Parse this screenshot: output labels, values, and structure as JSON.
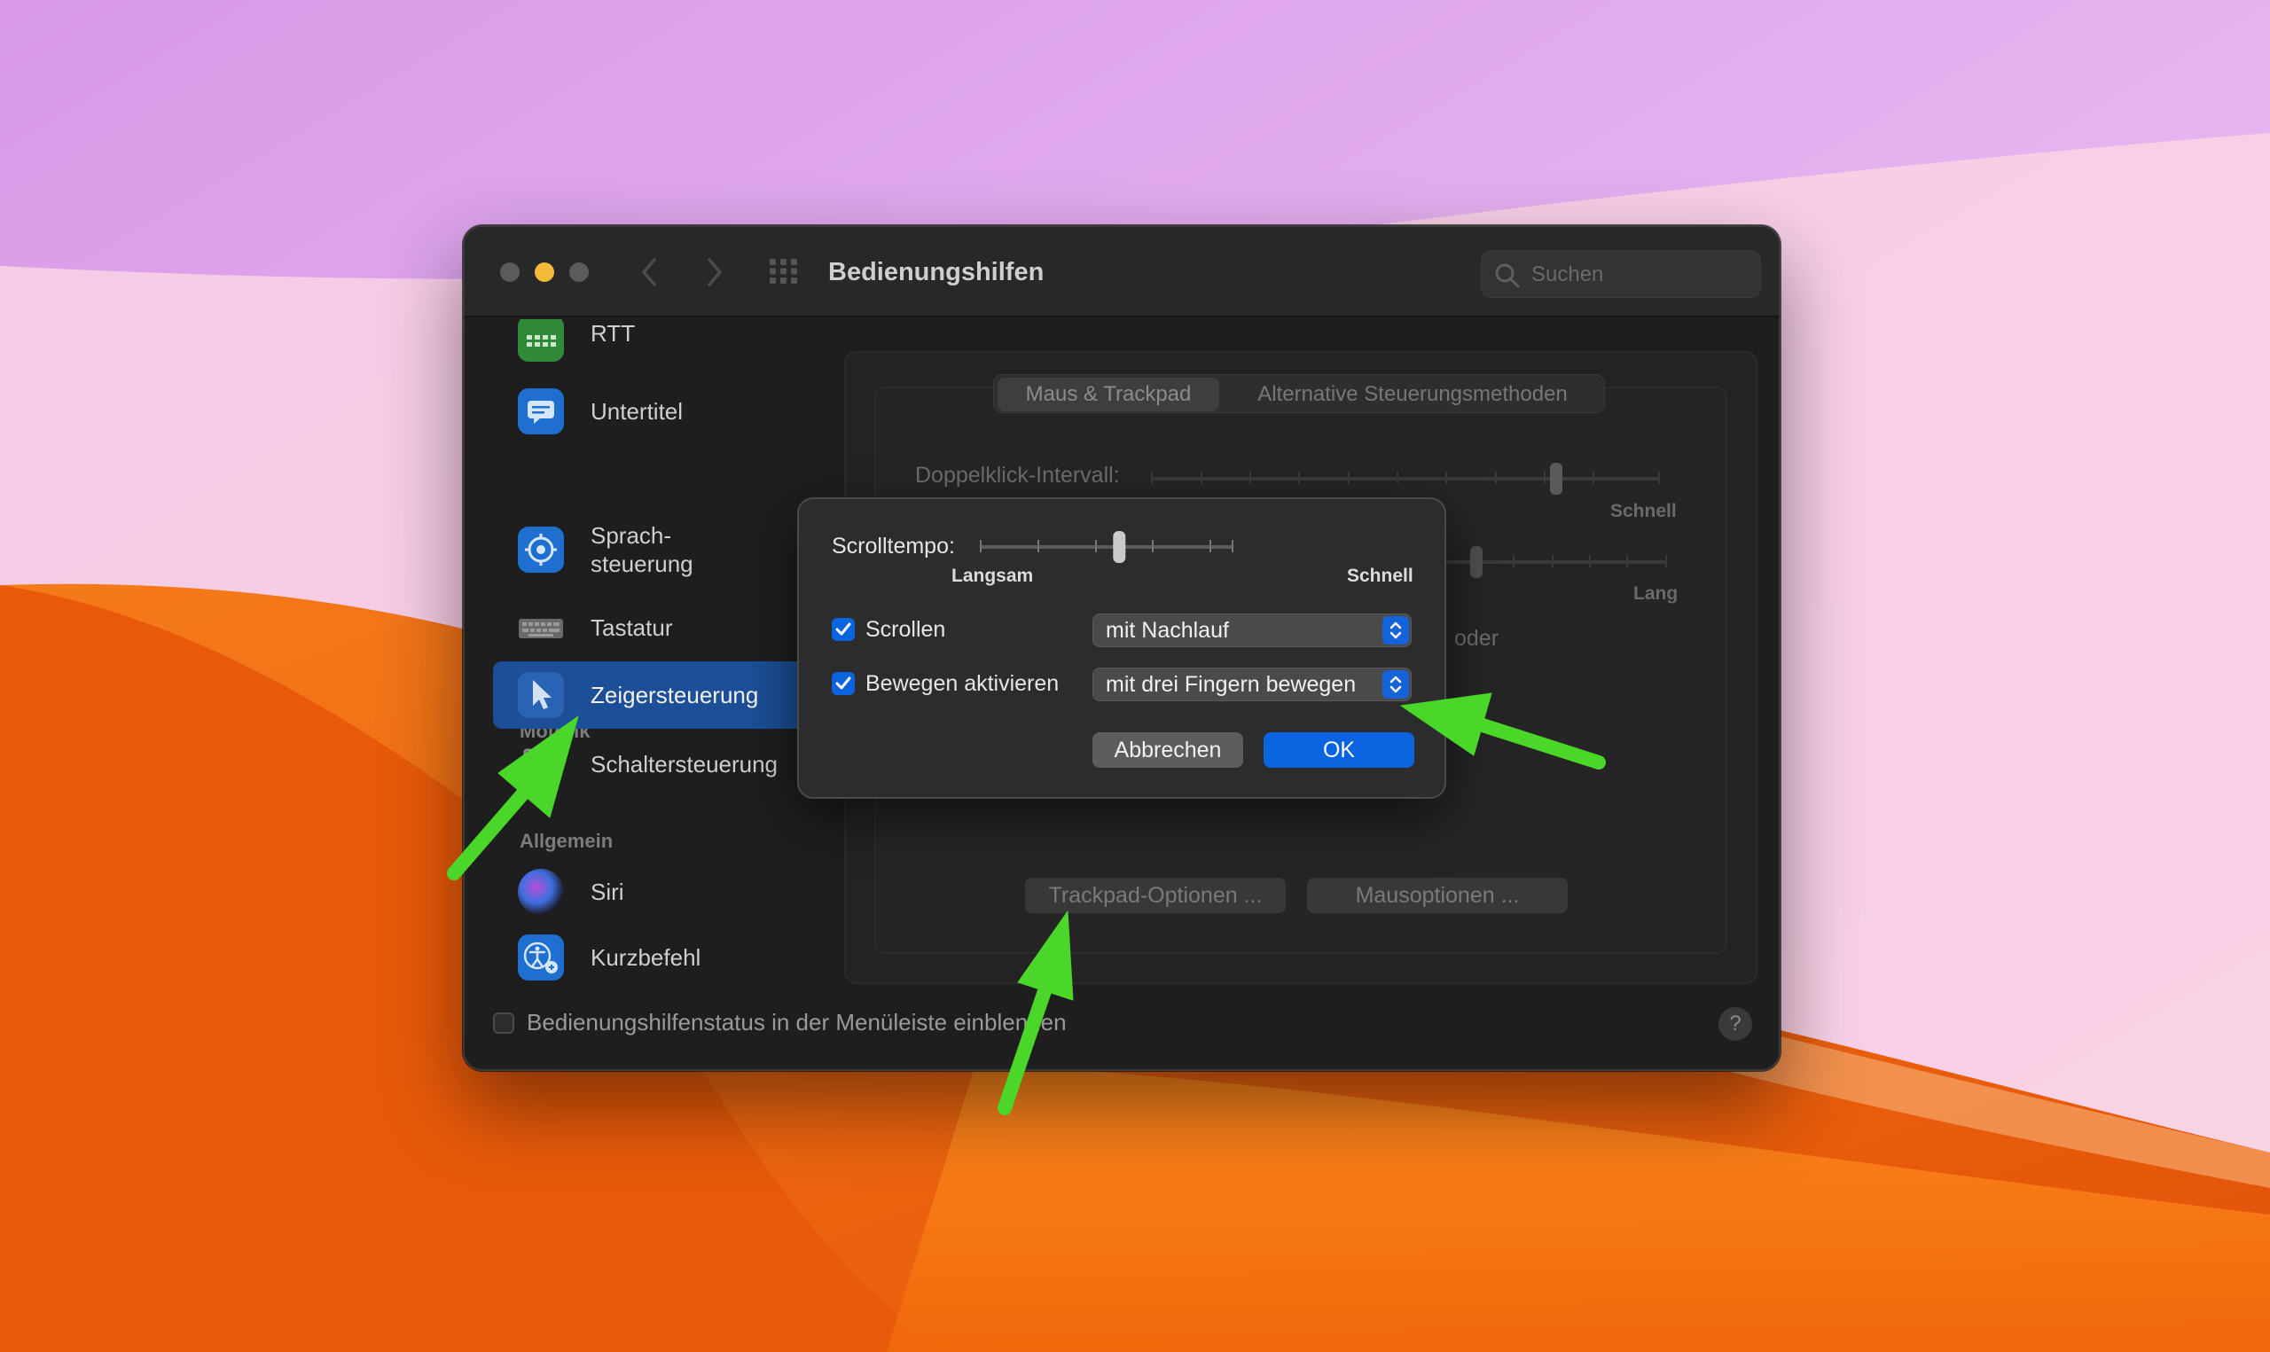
{
  "window": {
    "title": "Bedienungshilfen",
    "search_placeholder": "Suchen"
  },
  "sidebar": {
    "items": [
      {
        "label": "RTT",
        "icon": "rtt-keyboard-icon"
      },
      {
        "label": "Untertitel",
        "icon": "captions-icon"
      },
      {
        "label": "Sprach-",
        "label2": "steuerung",
        "icon": "voice-control-icon"
      },
      {
        "label": "Tastatur",
        "icon": "keyboard-icon"
      },
      {
        "label": "Zeigersteuerung",
        "icon": "pointer-icon",
        "selected": true
      },
      {
        "label": "Schaltersteuerung",
        "icon": "switch-control-icon"
      },
      {
        "label": "Siri",
        "icon": "siri-icon"
      },
      {
        "label": "Kurzbefehl",
        "icon": "accessibility-shortcut-icon"
      }
    ],
    "sections": {
      "motorik": "Motorik",
      "allgemein": "Allgemein"
    }
  },
  "tabs": {
    "tab1": "Maus & Trackpad",
    "tab2": "Alternative Steuerungsmethoden"
  },
  "main": {
    "doubleclick_label": "Doppelklick-Intervall:",
    "fast_label": "Schnell",
    "long_label": "Lang",
    "oder_fragment": "oder",
    "trackpad_options": "Trackpad-Optionen ...",
    "mouse_options": "Mausoptionen ..."
  },
  "bottom": {
    "status_label": "Bedienungshilfenstatus in der Menüleiste einblenden",
    "status_checked": false,
    "help": "?"
  },
  "dialog": {
    "scroll_speed_label": "Scrolltempo:",
    "scroll_speed_slow": "Langsam",
    "scroll_speed_fast": "Schnell",
    "scroll_speed_level": 0.55,
    "scroll_checkbox_label": "Scrollen",
    "scroll_checked": true,
    "scroll_mode": "mit Nachlauf",
    "drag_checkbox_label": "Bewegen aktivieren",
    "drag_checked": true,
    "drag_mode": "mit drei Fingern bewegen",
    "cancel": "Abbrechen",
    "ok": "OK"
  },
  "colors": {
    "accent": "#0a64e0",
    "selection": "#1c4f97",
    "annotation_arrow": "#4bd62a",
    "close_dot": "#5b5b5b",
    "minimize_dot": "#f5b93a"
  }
}
